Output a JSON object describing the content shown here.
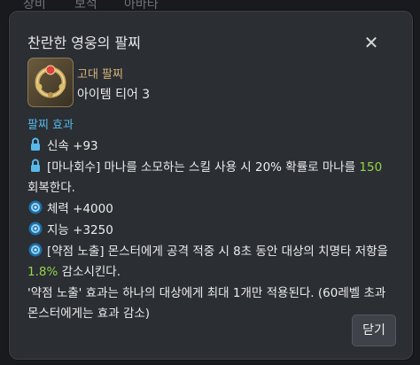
{
  "background": {
    "tabs": [
      "장비",
      "보석",
      "아바타"
    ]
  },
  "dialog": {
    "title": "찬란한 영웅의 팔찌",
    "close_icon": "close-x-icon",
    "item": {
      "grade": "고대 팔찌",
      "tier": "아이템 티어 3",
      "icon": "bracelet-icon"
    },
    "effects_title": "팔찌 효과",
    "effects": {
      "e1": "신속 +93",
      "e2_a": "[마나회수] 마나를 소모하는 스킬 사용 시 20% 확률로 마나를 ",
      "e2_num": "150",
      "e2_b": "회복한다.",
      "e3": "체력 +4000",
      "e4": "지능 +3250",
      "e5_a": "[약점 노출] 몬스터에게 공격 적중 시 8초 동안 대상의 치명타 저항을",
      "e5_pct": "1.8%",
      "e5_b": " 감소시킨다.",
      "note_a": "'약점 노출' 효과는 하나의 대상에게 최대 1개만 적용된다. (60레벨 초과",
      "note_b": "몬스터에게는 효과 감소)"
    },
    "close_button": "닫기"
  },
  "colors": {
    "accent_blue": "#55b7e6",
    "grade_gold": "#d5b47a",
    "value_green": "#92d54a"
  }
}
